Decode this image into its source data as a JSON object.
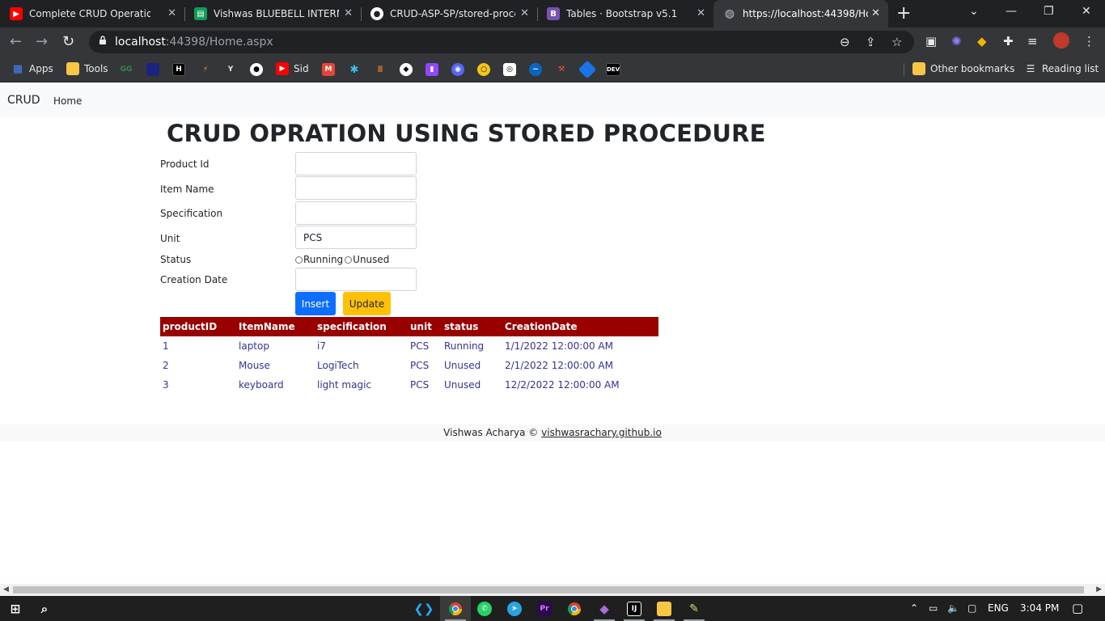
{
  "browser": {
    "tabs": [
      {
        "title": "Complete CRUD Operation in",
        "icon": "youtube-icon",
        "color": "#ff0000"
      },
      {
        "title": "Vishwas BLUEBELL INTERNSH",
        "icon": "google-sheets-icon",
        "color": "#0f9d58"
      },
      {
        "title": "CRUD-ASP-SP/stored-proced",
        "icon": "github-icon",
        "color": "#ffffff"
      },
      {
        "title": "Tables · Bootstrap v5.1",
        "icon": "bootstrap-icon",
        "color": "#7952b3"
      },
      {
        "title": "https://localhost:44398/Hom",
        "icon": "globe-icon",
        "color": "#bdc1c6"
      }
    ],
    "url_host": "localhost",
    "url_rest": ":44398/Home.aspx",
    "bookmarks": {
      "apps": "Apps",
      "tools": "Tools",
      "sid": "Sid",
      "dev": "DEV",
      "other": "Other bookmarks",
      "reading": "Reading list"
    }
  },
  "nav": {
    "brand": "CRUD",
    "home": "Home"
  },
  "page": {
    "title": "CRUD OPRATION USING STORED PROCEDURE"
  },
  "form": {
    "product_id_label": "Product Id",
    "item_name_label": "Item Name",
    "specification_label": "Specification",
    "unit_label": "Unit",
    "unit_value": "PCS",
    "status_label": "Status",
    "status_options": [
      "Running",
      "Unused"
    ],
    "creation_date_label": "Creation Date",
    "insert_label": "Insert",
    "update_label": "Update"
  },
  "table": {
    "headers": [
      "productID",
      "ItemName",
      "specification",
      "unit",
      "status",
      "CreationDate"
    ],
    "rows": [
      [
        "1",
        "laptop",
        "i7",
        "PCS",
        "Running",
        "1/1/2022 12:00:00 AM"
      ],
      [
        "2",
        "Mouse",
        "LogiTech",
        "PCS",
        "Unused",
        "2/1/2022 12:00:00 AM"
      ],
      [
        "3",
        "keyboard",
        "light magic",
        "PCS",
        "Unused",
        "12/2/2022 12:00:00 AM"
      ]
    ],
    "header_bg": "#990000",
    "cell_color": "#333399"
  },
  "footer": {
    "author": "Vishwas Acharya ©",
    "link": "vishwasrachary.github.io"
  },
  "taskbar": {
    "lang": "ENG",
    "time": "3:04 PM"
  }
}
